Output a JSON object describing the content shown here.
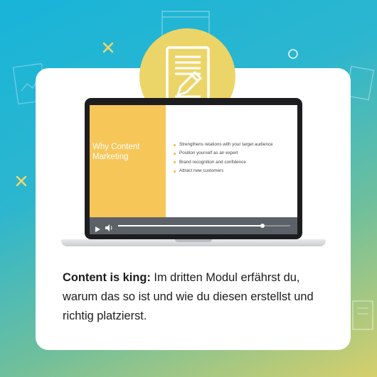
{
  "slide": {
    "title": "Why Content Marketing",
    "bullets": [
      "Strengthens relations with your target audience",
      "Position yourself as an expert",
      "Brand recognition and confidence",
      "Attract new customers"
    ]
  },
  "player": {
    "progress": 0.84
  },
  "caption": {
    "bold": "Content is king:",
    "text": " Im dritten Modul erfährst du, warum das so ist und wie du diesen erstellst und richtig platzierst."
  },
  "colors": {
    "accent_yellow": "#ecd568",
    "slide_yellow": "#f6c659",
    "background_top": "#18b4d9",
    "background_bottom": "#d6cf6b"
  },
  "icons": {
    "badge": "document-edit-icon",
    "play": "play-icon",
    "volume": "volume-icon"
  }
}
